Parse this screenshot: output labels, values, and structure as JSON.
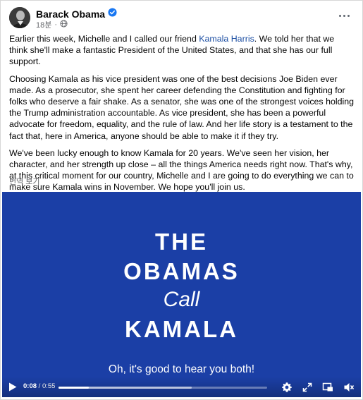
{
  "post": {
    "author": "Barack Obama",
    "time": "18분",
    "separator": "·",
    "paragraphs": {
      "p1_before": "Earlier this week, Michelle and I called our friend ",
      "p1_link": "Kamala Harris",
      "p1_after": ". We told her that we think she'll make a fantastic President of the United States, and that she has our full support.",
      "p2": "Choosing Kamala as his vice president was one of the best decisions Joe Biden ever made. As a prosecutor, she spent her career defending the Constitution and fighting for folks who deserve a fair shake. As a senator, she was one of the strongest voices holding the Trump administration accountable. As vice president, she has been a powerful advocate for freedom, equality, and the rule of law. And her life story is a testament to the fact that, here in America, anyone should be able to make it if they try.",
      "p3": "We've been lucky enough to know Kamala for 20 years. We've seen her vision, her character, and her strength up close – all the things America needs right now. That's why, at this critical moment for our country, Michelle and I are going to do everything we can to make sure Kamala wins in November. We hope you'll join us."
    },
    "translate_label": "번역 보기"
  },
  "video": {
    "title_lines": [
      "THE",
      "OBAMAS",
      "Call",
      "KAMALA"
    ],
    "caption": "Oh, it's good to hear you both!",
    "current_time": "0:08",
    "time_sep": " / ",
    "duration": "0:55",
    "played_fraction": 0.145,
    "buffered_fraction": 0.64,
    "background_color": "#1b3fa6"
  },
  "icons": {
    "verified": "verified-badge-icon",
    "audience": "globe-icon",
    "more": "more-options-icon",
    "play": "play-icon",
    "settings": "gear-icon",
    "expand": "expand-icon",
    "pip": "picture-in-picture-icon",
    "volume": "volume-muted-icon"
  },
  "colors": {
    "link": "#1d4fa3",
    "verified": "#1877f2",
    "meta_text": "#65676b"
  }
}
